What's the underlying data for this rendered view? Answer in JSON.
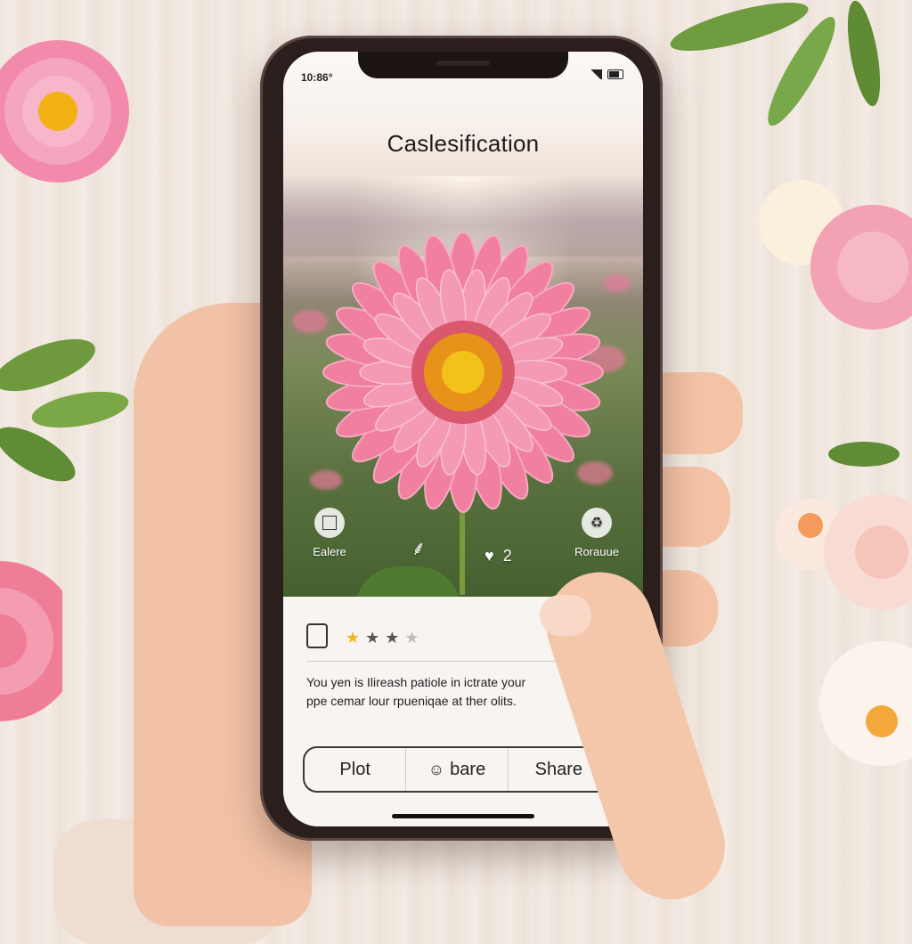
{
  "status": {
    "time": "10:86°"
  },
  "app": {
    "title": "Caslesification"
  },
  "overlay": {
    "left_action": "Ealere",
    "count_value": "2",
    "right_action": "Rorauue"
  },
  "card": {
    "rating": {
      "filled": 1,
      "dark": 2,
      "empty": 1,
      "total": 4
    },
    "description": "You yen is Ilireash patiole in ictrate your ppe cemar lour rpueniqae at ther olits."
  },
  "buttons": {
    "plot": "Plot",
    "bare": "bare",
    "share": "Share"
  },
  "colors": {
    "flower_petal": "#f07fa0",
    "flower_center": "#e3a11b",
    "star_filled": "#f2b71b",
    "accent_dark": "#3a3a3a"
  },
  "icons": [
    "square-icon",
    "leaf-sprout-icon",
    "heart-chat-icon",
    "recycle-icon",
    "card-icon",
    "star-icon"
  ]
}
